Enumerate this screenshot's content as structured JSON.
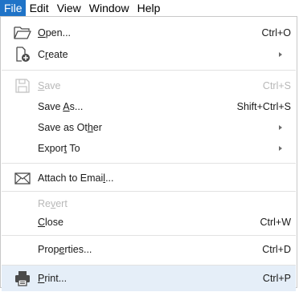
{
  "menubar": {
    "items": [
      {
        "label": "File",
        "active": true
      },
      {
        "label": "Edit",
        "active": false
      },
      {
        "label": "View",
        "active": false
      },
      {
        "label": "Window",
        "active": false
      },
      {
        "label": "Help",
        "active": false
      }
    ]
  },
  "file_menu": {
    "open": {
      "pre": "",
      "accel": "O",
      "post": "pen...",
      "shortcut": "Ctrl+O",
      "icon": "folder-open-icon"
    },
    "create": {
      "pre": "C",
      "accel": "r",
      "post": "eate",
      "submenu": true,
      "icon": "create-pdf-icon"
    },
    "save": {
      "pre": "",
      "accel": "S",
      "post": "ave",
      "shortcut": "Ctrl+S",
      "disabled": true,
      "icon": "save-icon"
    },
    "save_as": {
      "pre": "Save ",
      "accel": "A",
      "post": "s...",
      "shortcut": "Shift+Ctrl+S"
    },
    "save_as_other": {
      "pre": "Save as Ot",
      "accel": "h",
      "post": "er",
      "submenu": true
    },
    "export_to": {
      "pre": "Expor",
      "accel": "t",
      "post": " To",
      "submenu": true
    },
    "attach_to_email": {
      "pre": "Attach to Emai",
      "accel": "l",
      "post": "...",
      "icon": "envelope-icon"
    },
    "revert": {
      "pre": "Re",
      "accel": "v",
      "post": "ert",
      "disabled": true
    },
    "close": {
      "pre": "",
      "accel": "C",
      "post": "lose",
      "shortcut": "Ctrl+W"
    },
    "properties": {
      "pre": "Prop",
      "accel": "e",
      "post": "rties...",
      "shortcut": "Ctrl+D"
    },
    "print": {
      "pre": "",
      "accel": "P",
      "post": "rint...",
      "shortcut": "Ctrl+P",
      "highlighted": true,
      "icon": "printer-icon"
    }
  },
  "colors": {
    "menubar_active_bg": "#1f73c7",
    "highlight_bg": "#e5eef8",
    "disabled_text": "#b8b8b8"
  }
}
